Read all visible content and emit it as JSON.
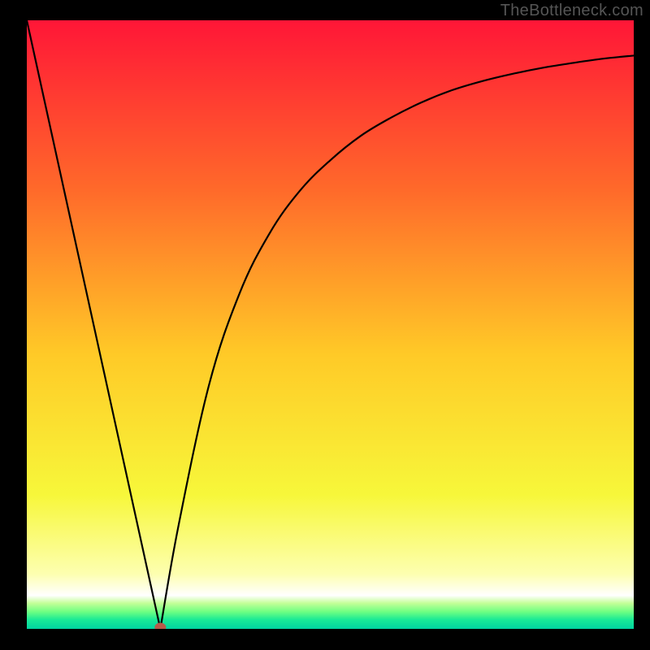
{
  "watermark": "TheBottleneck.com",
  "chart_data": {
    "type": "line",
    "title": "",
    "xlabel": "",
    "ylabel": "",
    "xlim": [
      0,
      100
    ],
    "ylim": [
      0,
      100
    ],
    "x": [
      0,
      5,
      10,
      15,
      20,
      22,
      25,
      30,
      35,
      40,
      45,
      50,
      55,
      60,
      65,
      70,
      75,
      80,
      85,
      90,
      95,
      100
    ],
    "values": [
      100,
      78.5,
      57,
      35.5,
      14,
      0,
      17,
      40,
      55,
      65,
      72,
      77,
      81,
      84,
      86.5,
      88.5,
      90,
      91.2,
      92.2,
      93,
      93.7,
      94.2
    ],
    "marker": {
      "x": 22,
      "y": 0,
      "color": "#b85a4a"
    },
    "gradient_stops": [
      {
        "pos": 0.0,
        "color": "#ff1637"
      },
      {
        "pos": 0.28,
        "color": "#ff6a2a"
      },
      {
        "pos": 0.55,
        "color": "#ffca27"
      },
      {
        "pos": 0.78,
        "color": "#f7f73a"
      },
      {
        "pos": 0.91,
        "color": "#fdffb0"
      },
      {
        "pos": 0.945,
        "color": "#ffffff"
      },
      {
        "pos": 0.958,
        "color": "#c3ff97"
      },
      {
        "pos": 0.972,
        "color": "#6dff82"
      },
      {
        "pos": 0.985,
        "color": "#19e996"
      },
      {
        "pos": 1.0,
        "color": "#00d3a0"
      }
    ]
  }
}
